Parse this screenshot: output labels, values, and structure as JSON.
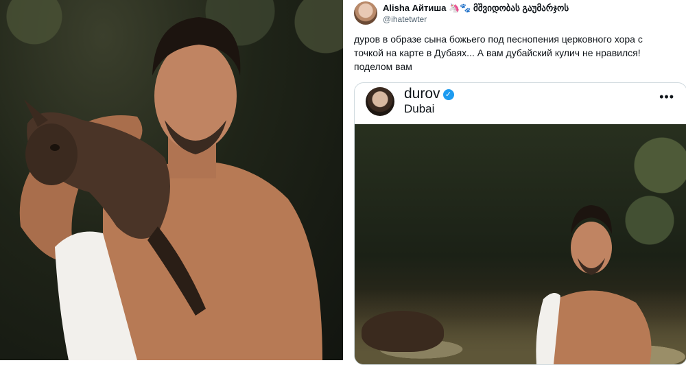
{
  "left_photo": {
    "description_icon": "portrait-with-goat-photo"
  },
  "tweet": {
    "author_name": "Alisha Айтиша 🦄🐾 მშვიდობას გაუმარჯოს",
    "author_handle": "@ihatetwter",
    "text_lines": [
      "дуров в образе сына божьего под песнопения церковного хора с",
      "точкой на карте в Дубаях... А вам дубайский кулич не нравился!",
      "поделом вам"
    ]
  },
  "embedded_post": {
    "username": "durov",
    "location": "Dubai",
    "more_icon": "more-options-icon",
    "verified_icon": "verified-badge-icon",
    "verified_glyph": "✓",
    "more_glyph": "•••"
  }
}
